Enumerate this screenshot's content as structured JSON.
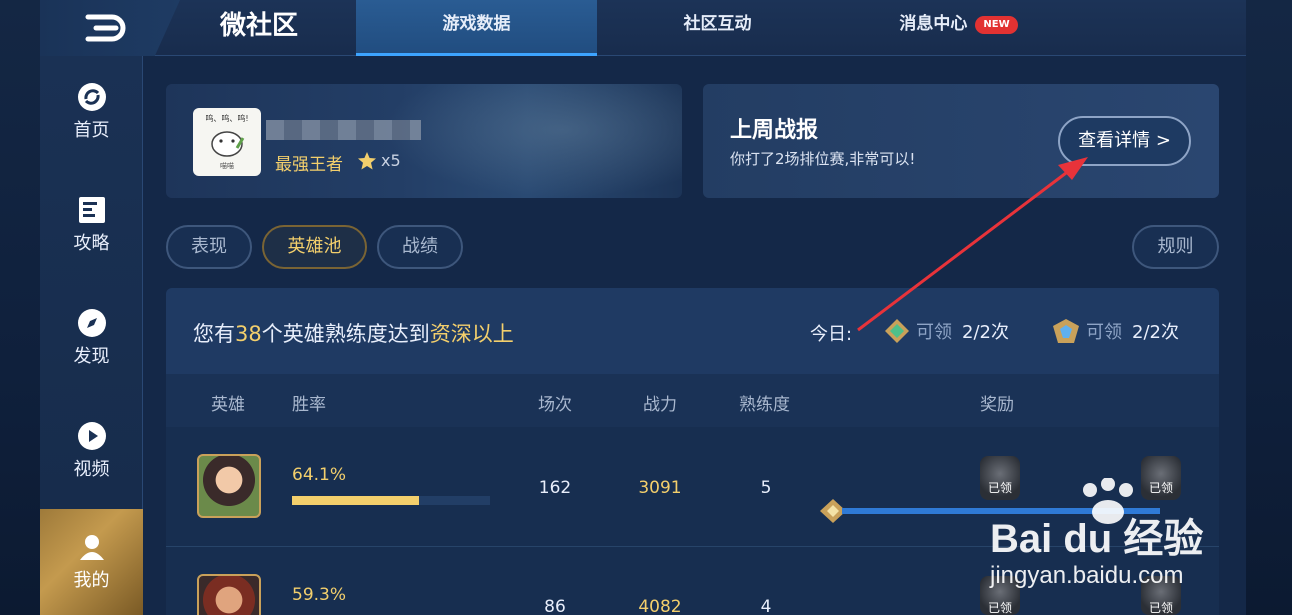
{
  "topbar": {
    "title": "微社区",
    "tabs": [
      {
        "label": "游戏数据",
        "active": true
      },
      {
        "label": "社区互动",
        "active": false
      },
      {
        "label": "消息中心",
        "active": false,
        "badge": "NEW"
      }
    ]
  },
  "sidebar": {
    "items": [
      {
        "label": "首页",
        "icon": "refresh-circle-icon"
      },
      {
        "label": "攻略",
        "icon": "document-icon"
      },
      {
        "label": "发现",
        "icon": "compass-icon"
      },
      {
        "label": "视频",
        "icon": "play-icon"
      },
      {
        "label": "我的",
        "icon": "user-icon",
        "active": true
      }
    ]
  },
  "profile": {
    "avatar_text": "呜、呜、呜!",
    "avatar_caption": "喵喵",
    "rank": "最强王者",
    "stars": "x5"
  },
  "weekly_report": {
    "title": "上周战报",
    "subtitle": "你打了2场排位赛,非常可以!",
    "button": "查看详情 >"
  },
  "subtabs": {
    "items": [
      {
        "label": "表现",
        "active": false
      },
      {
        "label": "英雄池",
        "active": true
      },
      {
        "label": "战绩",
        "active": false
      }
    ],
    "rules": "规则"
  },
  "summary": {
    "prefix": "您有",
    "count": "38",
    "middle": "个英雄熟练度达到",
    "level": "资深以上",
    "today_label": "今日:",
    "reward1_label": "可领",
    "reward1_count": "2/2次",
    "reward2_label": "可领",
    "reward2_count": "2/2次"
  },
  "table": {
    "headers": [
      "英雄",
      "胜率",
      "场次",
      "战力",
      "熟练度",
      "奖励"
    ],
    "rows": [
      {
        "winrate": "64.1%",
        "winrate_fraction": 0.641,
        "games": "162",
        "power": "3091",
        "mastery": "5",
        "claim_left": "已领",
        "claim_right": "已领"
      },
      {
        "winrate": "59.3%",
        "winrate_fraction": 0.593,
        "games": "86",
        "power": "4082",
        "mastery": "4",
        "claim_left": "已领",
        "claim_right": "已领"
      }
    ]
  },
  "watermark": {
    "logo": "Bai du 经验",
    "url": "jingyan.baidu.com"
  },
  "colors": {
    "accent_gold": "#f3cf6c",
    "accent_blue": "#3da4ff",
    "badge_red": "#e23232"
  }
}
